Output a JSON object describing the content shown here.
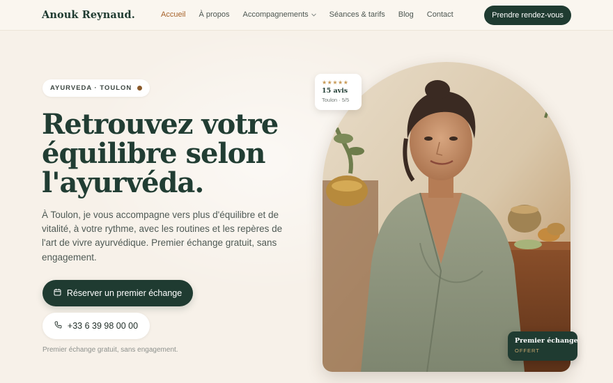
{
  "brand": {
    "name": "Anouk Reynaud."
  },
  "nav": {
    "items": [
      {
        "label": "Accueil",
        "active": true
      },
      {
        "label": "À propos"
      },
      {
        "label": "Accompagnements",
        "dropdown": true
      },
      {
        "label": "Séances & tarifs"
      },
      {
        "label": "Blog"
      },
      {
        "label": "Contact"
      }
    ],
    "cta": "Prendre rendez-vous"
  },
  "hero": {
    "badge": "AYURVEDA · TOULON",
    "headline_lines": [
      "Retrouvez votre",
      "équilibre selon",
      "l'ayurvéda."
    ],
    "lead": "À Toulon, je vous accompagne vers plus d'équilibre et de vitalité, à votre rythme, avec les routines et les repères de l'art de vivre ayurvédique. Premier échange gratuit, sans engagement.",
    "primary_button": "Réserver un premier échange",
    "phone_button": "+33 6 39 98 00 00",
    "note": "Premier échange gratuit, sans engagement."
  },
  "review_card": {
    "stars": "★★★★★",
    "count": "15 avis",
    "sub": "Toulon · 5/5"
  },
  "offer_card": {
    "title": "Premier échange",
    "sub": "OFFERT"
  },
  "icons": {
    "calendar": "calendar-icon",
    "phone": "phone-icon",
    "chevron": "chevron-down-icon",
    "dot": "status-dot-icon"
  },
  "colors": {
    "primary": "#1f3b31",
    "accent": "#a6622a",
    "background": "#f7f1e9",
    "gold": "#c79a57"
  }
}
